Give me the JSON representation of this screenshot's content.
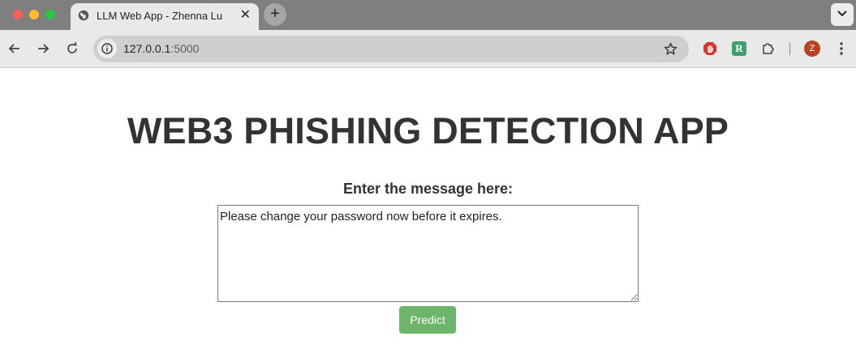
{
  "browser": {
    "tab": {
      "title": "LLM Web App - Zhenna Lu",
      "favicon": "globe-icon",
      "close_icon": "close-icon"
    },
    "new_tab_icon": "plus-icon",
    "tab_search_icon": "chevron-down-icon",
    "toolbar": {
      "back_icon": "arrow-left-icon",
      "forward_icon": "arrow-right-icon",
      "reload_icon": "reload-icon",
      "site_info_icon": "info-icon",
      "url_host": "127.0.0.1",
      "url_port": ":5000",
      "bookmark_icon": "star-icon",
      "extensions": [
        {
          "name": "stop-hand-extension-icon",
          "color": "#d9342b"
        },
        {
          "name": "r-extension-icon",
          "label": "R",
          "color": "#3fa06d"
        },
        {
          "name": "puzzle-icon"
        }
      ],
      "profile": {
        "initial": "Z",
        "color": "#b8431f"
      },
      "menu_icon": "kebab-menu-icon"
    }
  },
  "page": {
    "heading": "WEB3 PHISHING DETECTION APP",
    "prompt_label": "Enter the message here:",
    "message_value": "Please change your password now before it expires.",
    "predict_label": "Predict",
    "colors": {
      "heading_text": "#333333",
      "predict_button": "#6db56a"
    }
  }
}
